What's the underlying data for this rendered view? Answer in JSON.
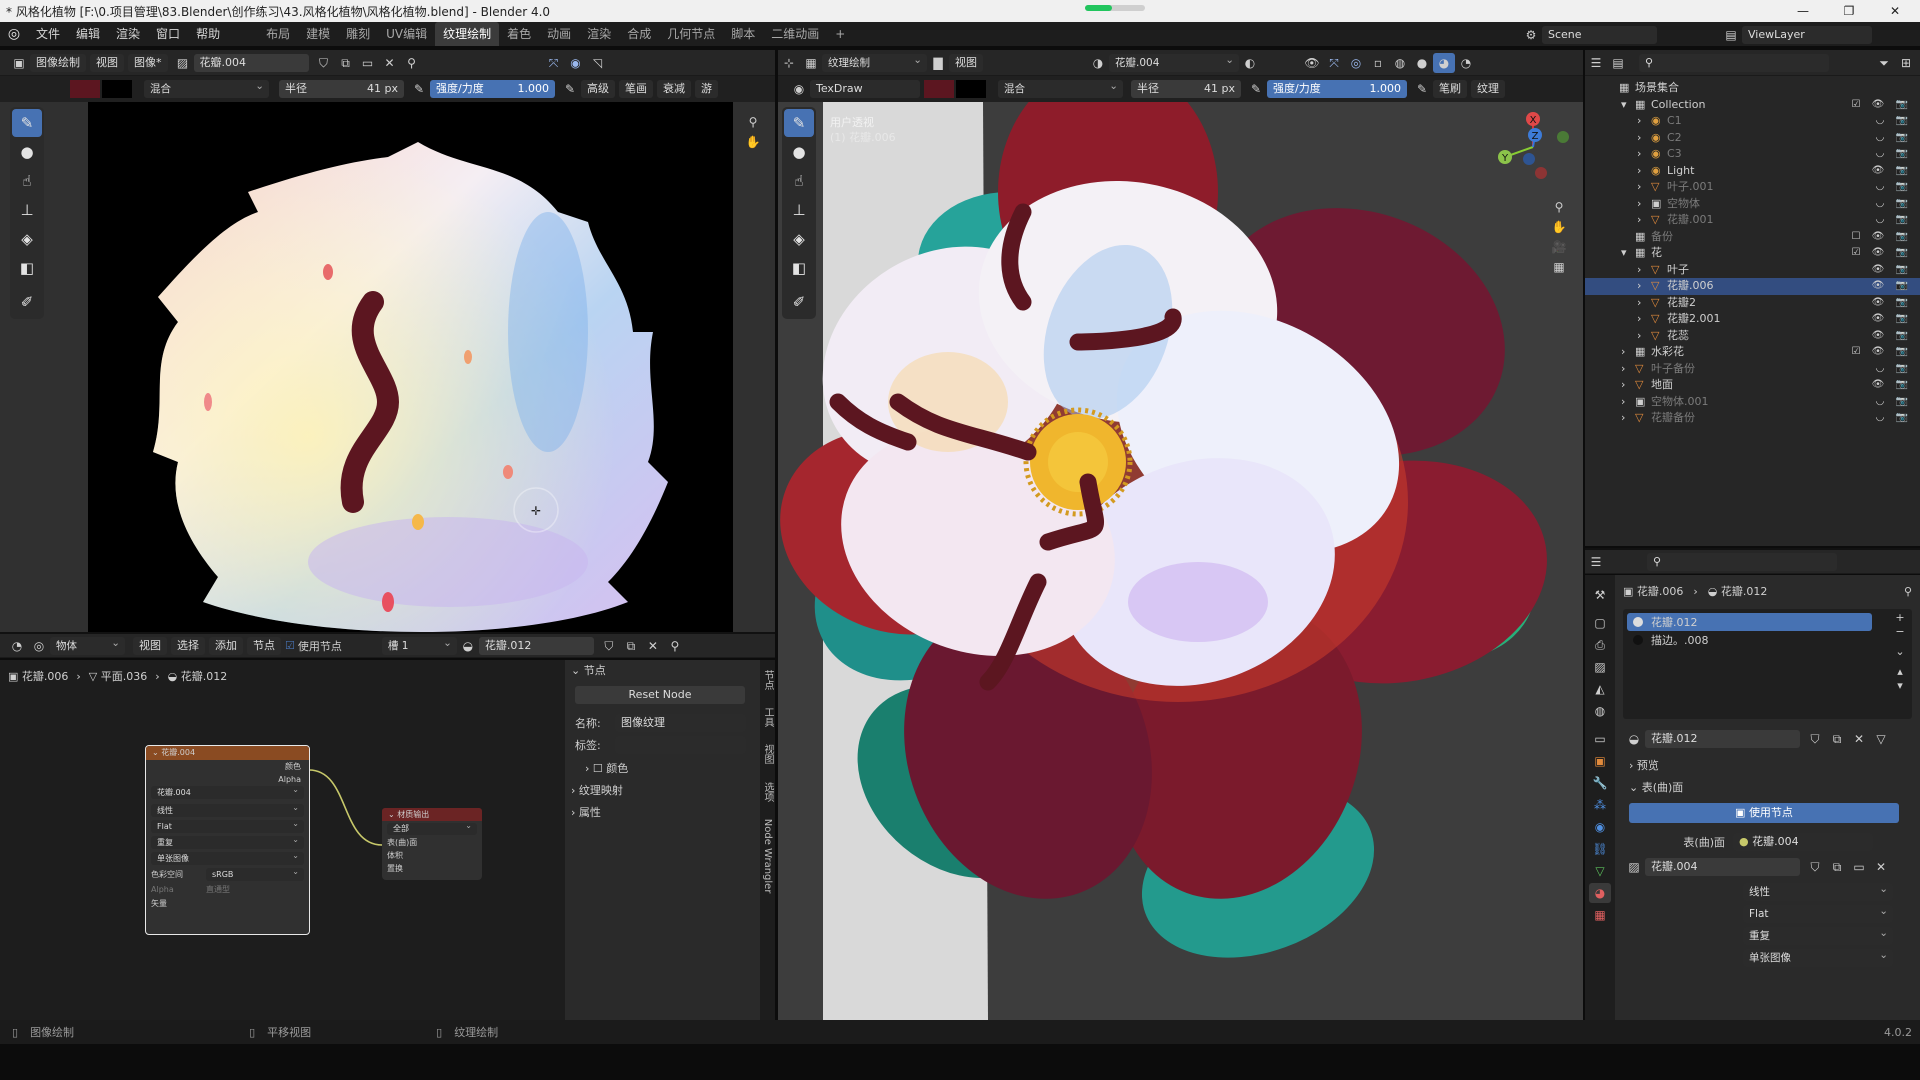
{
  "window": {
    "title": "* 风格化植物 [F:\\0.项目管理\\83.Blender\\创作练习\\43.风格化植物\\风格化植物.blend] - Blender 4.0",
    "progress": 0.45,
    "minimize": "—",
    "maximize": "❐",
    "close": "✕"
  },
  "menubar": {
    "items": [
      "文件",
      "编辑",
      "渲染",
      "窗口",
      "帮助"
    ],
    "workspaces": [
      "布局",
      "建模",
      "雕刻",
      "UV编辑",
      "纹理绘制",
      "着色",
      "动画",
      "渲染",
      "合成",
      "几何节点",
      "脚本",
      "二维动画"
    ],
    "active_workspace": "纹理绘制",
    "add": "+",
    "scene": "Scene",
    "view_layer": "ViewLayer"
  },
  "image_editor": {
    "mode": "图像绘制",
    "menus": [
      "视图",
      "图像*"
    ],
    "image_name": "花瓣.004",
    "blend": "混合",
    "radius_label": "半径",
    "radius_value": "41 px",
    "strength_label": "强度/力度",
    "strength_value": "1.000",
    "extra": [
      "高级",
      "笔画",
      "衰减",
      "游"
    ]
  },
  "viewport": {
    "mode": "纹理绘制",
    "menu": "视图",
    "material": "花瓣.004",
    "brush": "TexDraw",
    "blend": "混合",
    "radius_label": "半径",
    "radius_value": "41 px",
    "strength_label": "强度/力度",
    "strength_value": "1.000",
    "extra": [
      "笔刷",
      "纹理"
    ],
    "overlay_title": "用户透视",
    "overlay_sub": "(1) 花瓣.006",
    "axes": {
      "x": "X",
      "y": "Y",
      "z": "Z"
    }
  },
  "node_editor": {
    "type": "物体",
    "menus": [
      "视图",
      "选择",
      "添加",
      "节点"
    ],
    "use_nodes": "使用节点",
    "slot": "槽 1",
    "material": "花瓣.012",
    "breadcrumb": [
      "花瓣.006",
      "平面.036",
      "花瓣.012"
    ],
    "tex_node": {
      "title": "花瓣.004",
      "out_color": "颜色",
      "out_alpha": "Alpha",
      "image": "花瓣.004",
      "interp": "线性",
      "proj": "Flat",
      "ext": "重复",
      "source": "单张图像",
      "cs_label": "色彩空间",
      "cs_value": "sRGB",
      "alpha_label": "Alpha",
      "alpha_value": "直通型",
      "in_vector": "矢量"
    },
    "out_node": {
      "title": "材质输出",
      "target": "全部",
      "in_surface": "表(曲)面",
      "in_volume": "体积",
      "in_disp": "置换"
    },
    "side": {
      "section": "节点",
      "reset": "Reset Node",
      "name_label": "名称:",
      "name_value": "图像纹理",
      "label_label": "标签:",
      "color": "颜色",
      "mapping": "纹理映射",
      "props": "属性",
      "tabs": [
        "节点",
        "工具",
        "视图",
        "选项",
        "Node Wrangler"
      ]
    }
  },
  "outliner": {
    "search_placeholder": "",
    "rows": [
      {
        "indent": 0,
        "arrow": "",
        "icon": "▦",
        "label": "场景集合",
        "sel": false,
        "dim": false,
        "vis": ""
      },
      {
        "indent": 1,
        "arrow": "▾",
        "icon": "▦",
        "label": "Collection",
        "sel": false,
        "dim": false,
        "vis": "☑ 👁 📷"
      },
      {
        "indent": 2,
        "arrow": "›",
        "icon": "◉",
        "label": "C1",
        "sel": false,
        "dim": true,
        "vis": "◡ 📷"
      },
      {
        "indent": 2,
        "arrow": "›",
        "icon": "◉",
        "label": "C2",
        "sel": false,
        "dim": true,
        "vis": "◡ 📷"
      },
      {
        "indent": 2,
        "arrow": "›",
        "icon": "◉",
        "label": "C3",
        "sel": false,
        "dim": true,
        "vis": "◡ 📷"
      },
      {
        "indent": 2,
        "arrow": "›",
        "icon": "◉",
        "label": "Light",
        "sel": false,
        "dim": false,
        "vis": "👁 📷"
      },
      {
        "indent": 2,
        "arrow": "›",
        "icon": "▽",
        "label": "叶子.001",
        "sel": false,
        "dim": true,
        "vis": "◡ 📷"
      },
      {
        "indent": 2,
        "arrow": "›",
        "icon": "▣",
        "label": "空物体",
        "sel": false,
        "dim": true,
        "vis": "◡ 📷"
      },
      {
        "indent": 2,
        "arrow": "›",
        "icon": "▽",
        "label": "花瓣.001",
        "sel": false,
        "dim": true,
        "vis": "◡ 📷"
      },
      {
        "indent": 1,
        "arrow": "",
        "icon": "▦",
        "label": "备份",
        "sel": false,
        "dim": true,
        "vis": "☐ 👁 📷"
      },
      {
        "indent": 1,
        "arrow": "▾",
        "icon": "▦",
        "label": "花",
        "sel": false,
        "dim": false,
        "vis": "☑ 👁 📷"
      },
      {
        "indent": 2,
        "arrow": "›",
        "icon": "▽",
        "label": "叶子",
        "sel": false,
        "dim": false,
        "vis": "👁 📷"
      },
      {
        "indent": 2,
        "arrow": "›",
        "icon": "▽",
        "label": "花瓣.006",
        "sel": true,
        "dim": false,
        "vis": "👁 📷"
      },
      {
        "indent": 2,
        "arrow": "›",
        "icon": "▽",
        "label": "花瓣2",
        "sel": false,
        "dim": false,
        "vis": "👁 📷"
      },
      {
        "indent": 2,
        "arrow": "›",
        "icon": "▽",
        "label": "花瓣2.001",
        "sel": false,
        "dim": false,
        "vis": "👁 📷"
      },
      {
        "indent": 2,
        "arrow": "›",
        "icon": "▽",
        "label": "花蕊",
        "sel": false,
        "dim": false,
        "vis": "👁 📷"
      },
      {
        "indent": 1,
        "arrow": "›",
        "icon": "▦",
        "label": "水彩花",
        "sel": false,
        "dim": false,
        "vis": "☑ 👁 📷"
      },
      {
        "indent": 1,
        "arrow": "›",
        "icon": "▽",
        "label": "叶子备份",
        "sel": false,
        "dim": true,
        "vis": "◡ 📷"
      },
      {
        "indent": 1,
        "arrow": "›",
        "icon": "▽",
        "label": "地面",
        "sel": false,
        "dim": false,
        "vis": "👁 📷"
      },
      {
        "indent": 1,
        "arrow": "›",
        "icon": "▣",
        "label": "空物体.001",
        "sel": false,
        "dim": true,
        "vis": "◡ 📷"
      },
      {
        "indent": 1,
        "arrow": "›",
        "icon": "▽",
        "label": "花瓣备份",
        "sel": false,
        "dim": true,
        "vis": "◡ 📷"
      }
    ]
  },
  "properties": {
    "crumb_object": "花瓣.006",
    "crumb_material": "花瓣.012",
    "slots": [
      "花瓣.012",
      "描边。.008"
    ],
    "material": "花瓣.012",
    "preview": "预览",
    "surface_section": "表(曲)面",
    "use_nodes": "使用节点",
    "surface_label": "表(曲)面",
    "surface_value": "花瓣.004",
    "image": "花瓣.004",
    "interp": "线性",
    "proj": "Flat",
    "ext": "重复",
    "source": "单张图像"
  },
  "statusbar": {
    "left": "图像绘制",
    "mid": "平移视图",
    "right": "纹理绘制",
    "version": "4.0.2"
  },
  "colors": {
    "accent": "#4772b3",
    "brush_color": "#5c1620",
    "selected_row": "#334d80",
    "node_header_tex": "#8a4b22",
    "node_header_out": "#6b2424"
  }
}
